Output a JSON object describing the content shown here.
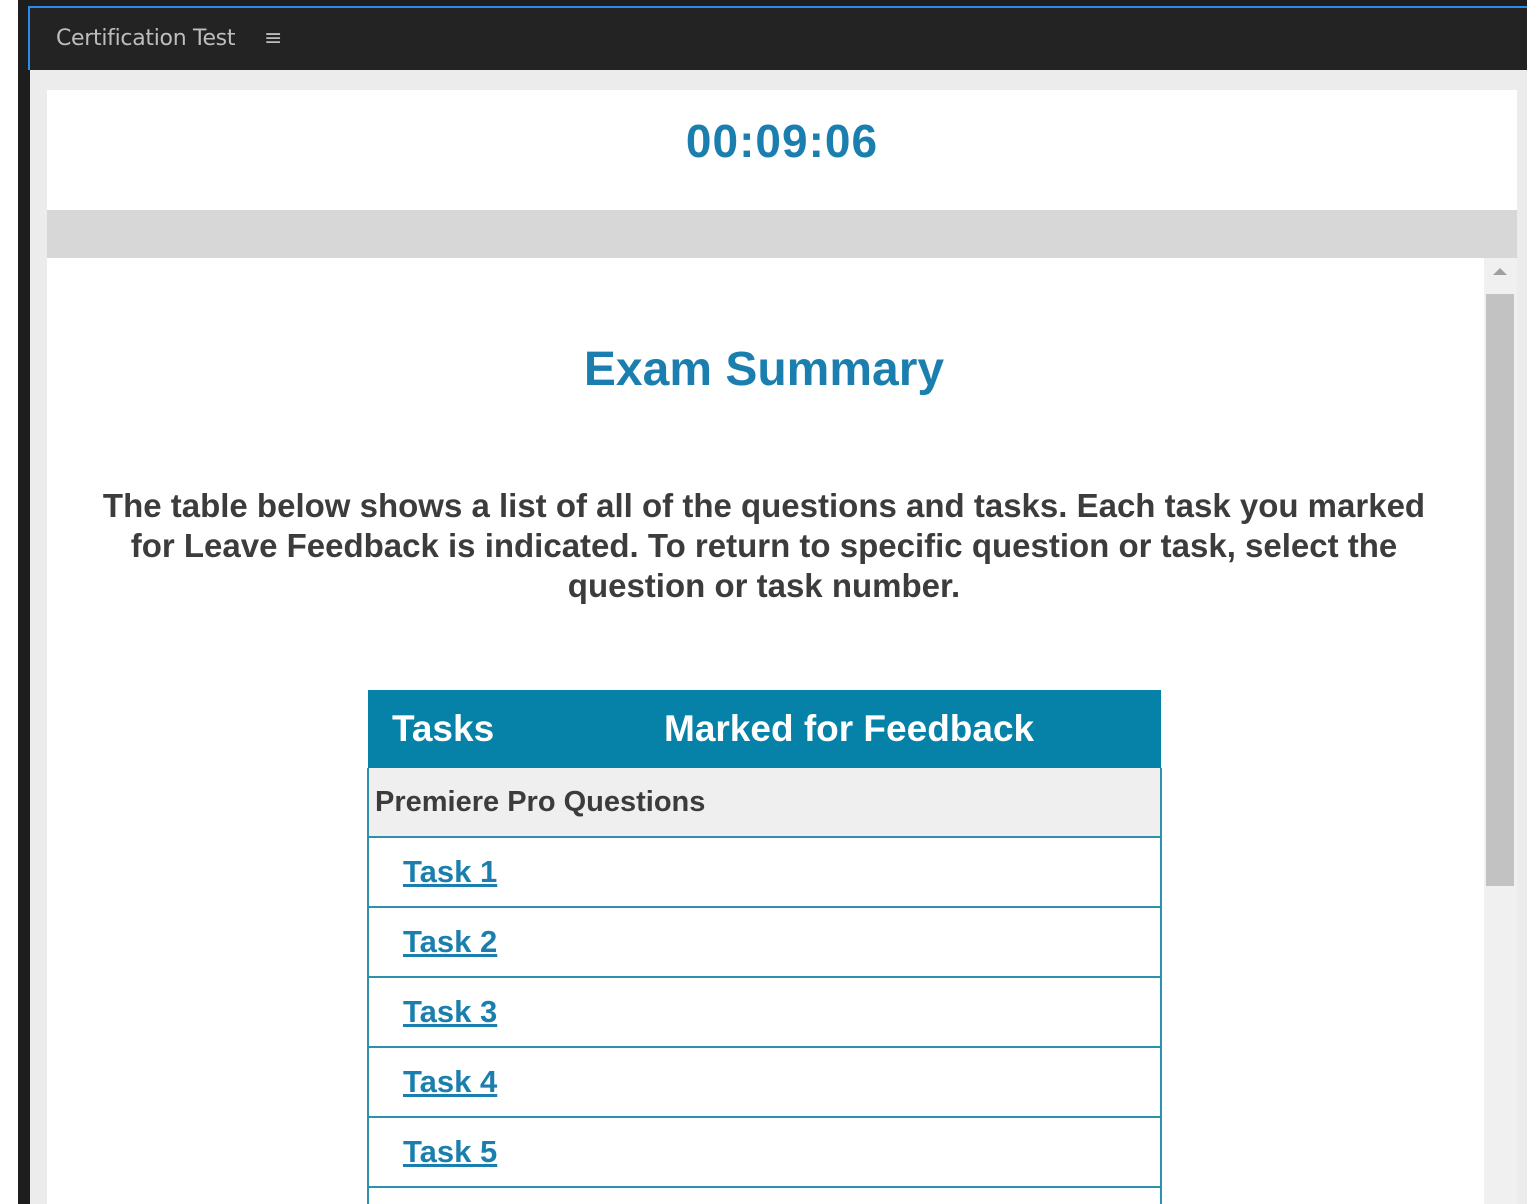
{
  "window": {
    "panel_title": "Certification Test",
    "menu_icon": "≡"
  },
  "timer": {
    "value": "00:09:06"
  },
  "summary": {
    "heading": "Exam Summary",
    "intro": "The table below shows a list of all of the questions and tasks. Each task you marked for Leave Feedback is indicated. To return to specific question or task, select the question or task number."
  },
  "table": {
    "columns": [
      "Tasks",
      "Marked for Feedback"
    ],
    "section_label": "Premiere Pro Questions",
    "tasks": [
      {
        "label": "Task 1",
        "marked": ""
      },
      {
        "label": "Task 2",
        "marked": ""
      },
      {
        "label": "Task 3",
        "marked": ""
      },
      {
        "label": "Task 4",
        "marked": ""
      },
      {
        "label": "Task 5",
        "marked": ""
      }
    ]
  },
  "colors": {
    "accent": "#1a7fae",
    "table_header": "#0681a8",
    "titlebar": "#232323"
  }
}
